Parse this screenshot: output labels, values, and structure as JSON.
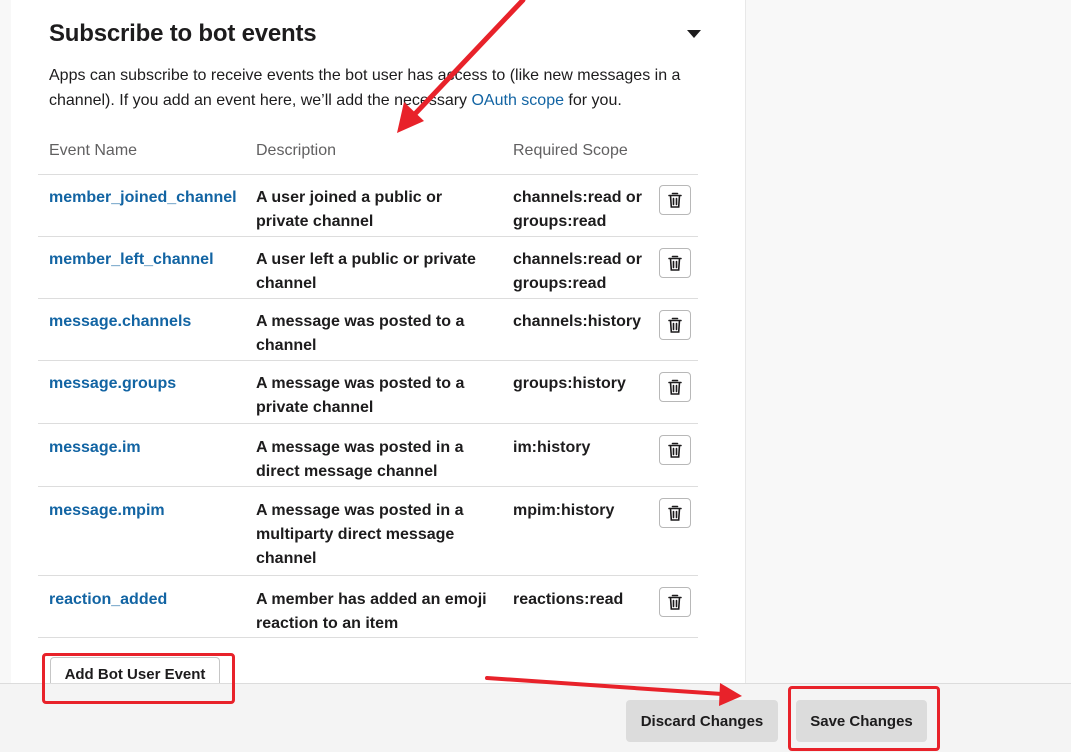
{
  "section": {
    "title": "Subscribe to bot events",
    "description_prefix": "Apps can subscribe to receive events the bot user has access to (like new messages in a channel). If you add an event here, we’ll add the necessary ",
    "oauth_link": "OAuth scope",
    "description_suffix": " for you."
  },
  "table": {
    "headers": [
      "Event Name",
      "Description",
      "Required Scope"
    ],
    "rows": [
      {
        "event": "member_joined_channel",
        "desc": "A user joined a public or private channel",
        "scope": "channels:read or groups:read"
      },
      {
        "event": "member_left_channel",
        "desc": "A user left a public or private channel",
        "scope": "channels:read or groups:read"
      },
      {
        "event": "message.channels",
        "desc": "A message was posted to a channel",
        "scope": "channels:history"
      },
      {
        "event": "message.groups",
        "desc": "A message was posted to a private channel",
        "scope": "groups:history"
      },
      {
        "event": "message.im",
        "desc": "A message was posted in a direct message channel",
        "scope": "im:history"
      },
      {
        "event": "message.mpim",
        "desc": "A message was posted in a multiparty direct message channel",
        "scope": "mpim:history"
      },
      {
        "event": "reaction_added",
        "desc": "A member has added an emoji reaction to an item",
        "scope": "reactions:read"
      }
    ]
  },
  "buttons": {
    "add_event": "Add Bot User Event",
    "discard": "Discard Changes",
    "save": "Save Changes"
  },
  "colors": {
    "link": "#1264a3",
    "annotation": "#e8222a"
  },
  "icons": {
    "collapse": "caret-down-icon",
    "delete": "trash-icon"
  }
}
